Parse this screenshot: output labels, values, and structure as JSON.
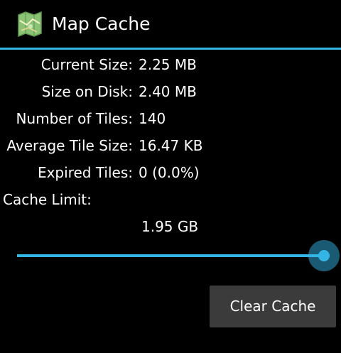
{
  "action_bar": {
    "title": "Map Cache",
    "icon": "map-icon"
  },
  "stats": [
    {
      "label": "Current Size:",
      "value": "2.25 MB"
    },
    {
      "label": "Size on Disk:",
      "value": "2.40 MB"
    },
    {
      "label": "Number of Tiles:",
      "value": "140"
    },
    {
      "label": "Average Tile Size:",
      "value": "16.47 KB"
    },
    {
      "label": "Expired Tiles:",
      "value": "0 (0.0%)"
    }
  ],
  "cache_limit": {
    "label": "Cache Limit:",
    "value": "1.95 GB",
    "slider_fraction": 1.0
  },
  "buttons": {
    "clear_cache": "Clear Cache"
  },
  "colors": {
    "accent": "#33b5e5",
    "background": "#000000",
    "button": "#3b3b3b",
    "text": "#ffffff"
  }
}
